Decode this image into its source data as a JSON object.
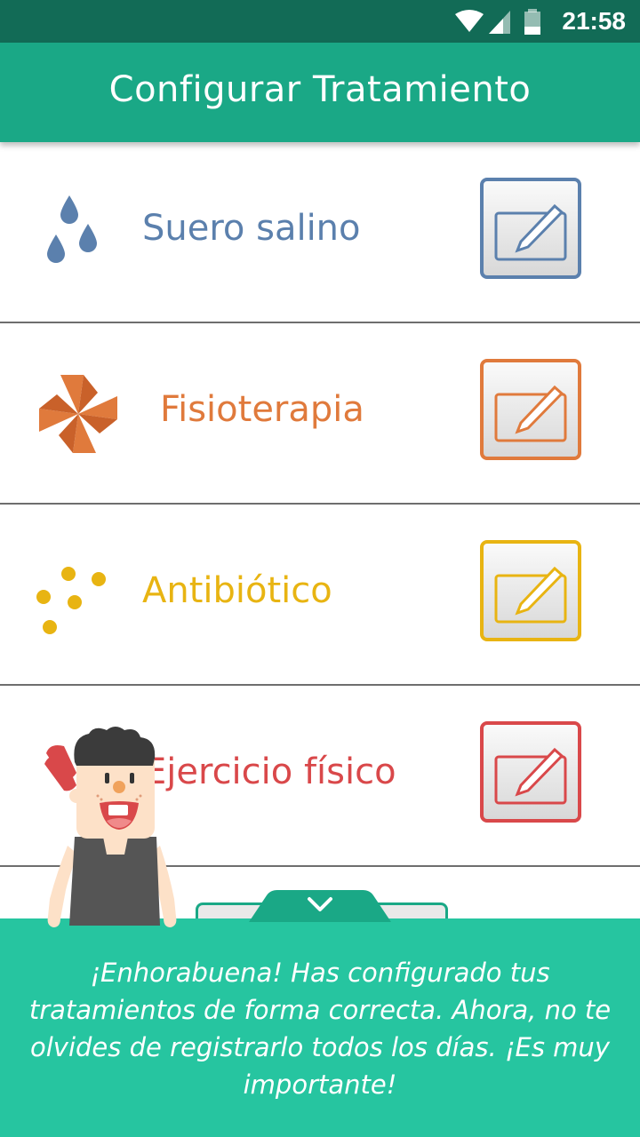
{
  "status_bar": {
    "time": "21:58"
  },
  "app_bar": {
    "title": "Configurar Tratamiento"
  },
  "treatments": [
    {
      "label": "Suero salino",
      "color": "#5b80ad"
    },
    {
      "label": "Fisioterapia",
      "color": "#e07a3c"
    },
    {
      "label": "Antibiótico",
      "color": "#e8b412"
    },
    {
      "label": "Ejercicio físico",
      "color": "#d9484a"
    }
  ],
  "bottom_panel": {
    "message": "¡Enhorabuena! Has configurado tus tratamientos de forma correcta. Ahora, no te olvides de registrarlo todos los días. ¡Es muy importante!"
  },
  "colors": {
    "header": "#1aa886",
    "status_bar": "#126b56",
    "panel": "#26c5a0"
  }
}
